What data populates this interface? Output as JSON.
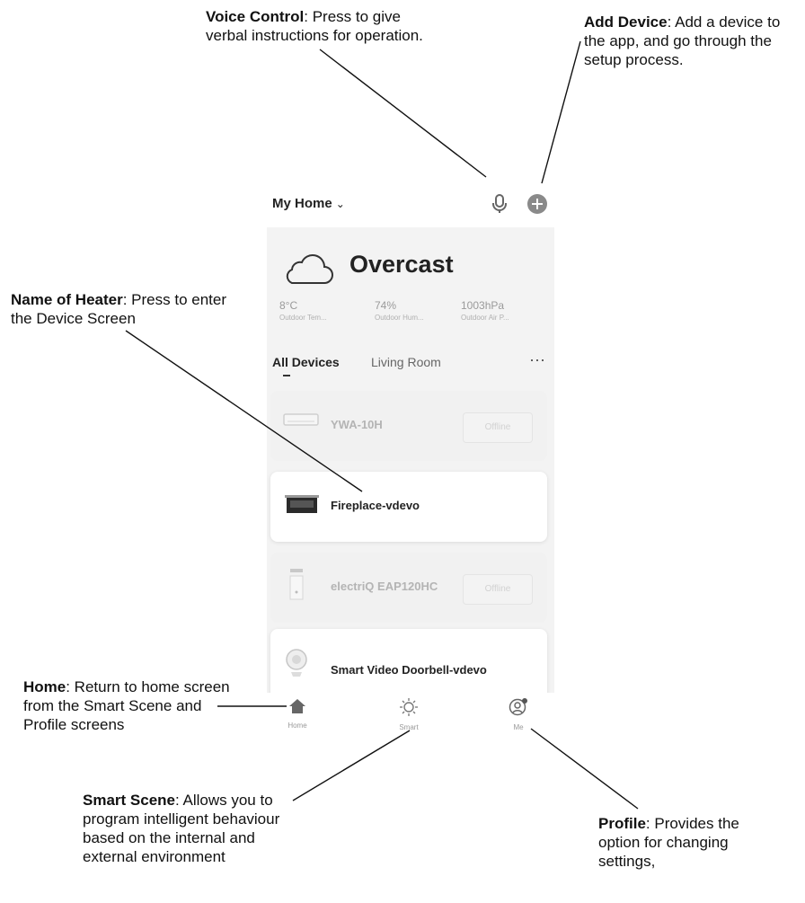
{
  "callouts": {
    "voice": {
      "title": "Voice Control",
      "text": ": Press to give verbal instructions for operation."
    },
    "add": {
      "title": "Add Device",
      "text": ": Add a device to the app, and go through the setup process."
    },
    "heater": {
      "title": "Name of Heater",
      "text": ": Press to enter the Device Screen"
    },
    "home": {
      "title": "Home",
      "text": ": Return to home screen from the Smart Scene and Profile screens"
    },
    "smart": {
      "title": "Smart Scene",
      "text": ": Allows you to program intelligent behaviour based on the internal and external environment"
    },
    "profile": {
      "title": "Profile",
      "text": ": Provides the option for changing settings,"
    }
  },
  "app": {
    "home_title": "My Home",
    "mic_icon": "microphone-icon",
    "add_icon": "plus-circle-icon",
    "weather": {
      "icon": "cloud-icon",
      "condition": "Overcast",
      "stats": [
        {
          "value": "8°C",
          "label": "Outdoor Tem..."
        },
        {
          "value": "74%",
          "label": "Outdoor Hum..."
        },
        {
          "value": "1003hPa",
          "label": "Outdoor Air P..."
        }
      ]
    },
    "tabs": [
      "All Devices",
      "Living Room"
    ],
    "more_icon": "more-dots-icon",
    "devices": [
      {
        "name": "YWA-10H",
        "status": "Offline",
        "icon": "air-conditioner-icon"
      },
      {
        "name": "Fireplace-vdevo",
        "status": "",
        "icon": "fireplace-icon"
      },
      {
        "name": "electriQ EAP120HC",
        "status": "Offline",
        "icon": "air-purifier-icon"
      },
      {
        "name": "Smart Video Doorbell-vdevo",
        "status": "",
        "icon": "doorbell-camera-icon"
      }
    ],
    "nav": [
      {
        "label": "Home",
        "icon": "home-icon"
      },
      {
        "label": "Smart",
        "icon": "sun-icon"
      },
      {
        "label": "Me",
        "icon": "user-icon"
      }
    ]
  },
  "colors": {
    "accent": "#8a8a8a",
    "background": "#f3f3f3"
  }
}
